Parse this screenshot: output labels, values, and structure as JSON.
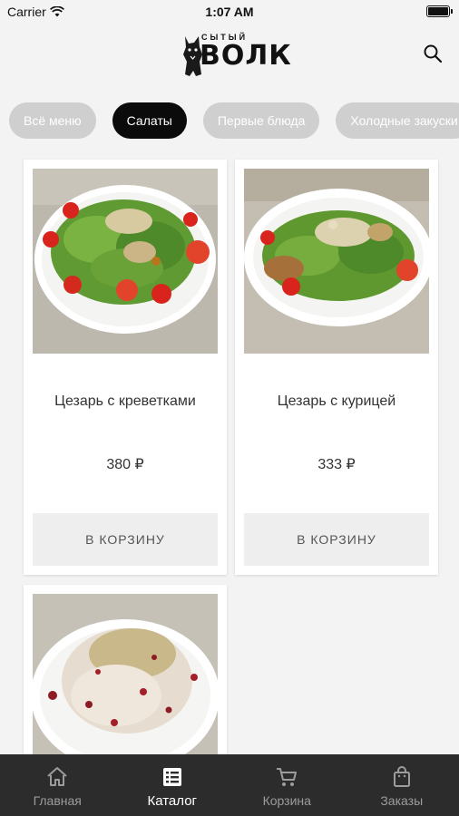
{
  "status_bar": {
    "carrier": "Carrier",
    "time": "1:07 AM"
  },
  "header": {
    "logo_top": "СЫТЫЙ",
    "logo_main": "ВОЛК",
    "search_icon": "search-icon"
  },
  "categories": [
    {
      "label": "Всё меню",
      "active": false
    },
    {
      "label": "Салаты",
      "active": true
    },
    {
      "label": "Первые блюда",
      "active": false
    },
    {
      "label": "Холодные закуски",
      "active": false
    }
  ],
  "products": [
    {
      "name": "Цезарь с креветками",
      "price": "380 ₽",
      "button": "В КОРЗИНУ"
    },
    {
      "name": "Цезарь с курицей",
      "price": "333 ₽",
      "button": "В КОРЗИНУ"
    },
    {
      "name": "",
      "price": "",
      "button": ""
    }
  ],
  "tabs": [
    {
      "label": "Главная",
      "icon": "home-icon",
      "active": false
    },
    {
      "label": "Каталог",
      "icon": "catalog-icon",
      "active": true
    },
    {
      "label": "Корзина",
      "icon": "cart-icon",
      "active": false
    },
    {
      "label": "Заказы",
      "icon": "bag-icon",
      "active": false
    }
  ],
  "colors": {
    "background": "#f3f3f3",
    "chip_inactive": "#cfcfcf",
    "chip_active": "#0b0b0b",
    "tabbar": "#2c2c2c",
    "button": "#eeeeee"
  }
}
